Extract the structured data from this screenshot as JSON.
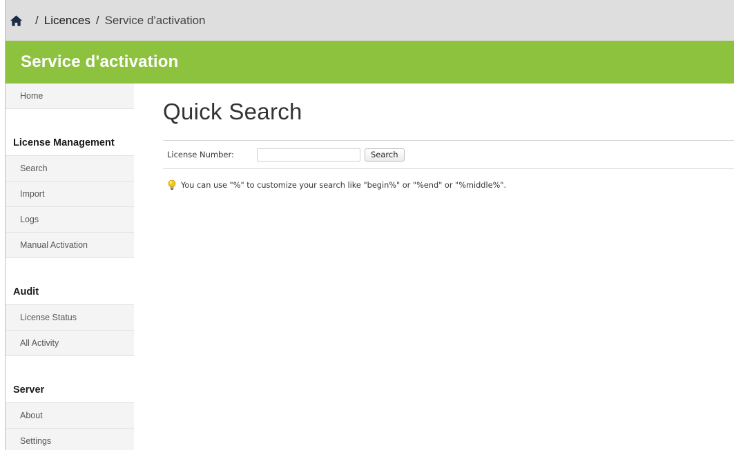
{
  "breadcrumb": {
    "home_icon": "home-icon",
    "separator": "/",
    "items": [
      {
        "label": "Licences"
      },
      {
        "label": "Service d'activation"
      }
    ]
  },
  "header": {
    "title": "Service d'activation",
    "color": "#8dc23f"
  },
  "sidebar": {
    "home": "Home",
    "sections": [
      {
        "title": "License Management",
        "items": [
          "Search",
          "Import",
          "Logs",
          "Manual Activation"
        ]
      },
      {
        "title": "Audit",
        "items": [
          "License Status",
          "All Activity"
        ]
      },
      {
        "title": "Server",
        "items": [
          "About",
          "Settings"
        ]
      }
    ]
  },
  "main": {
    "title": "Quick Search",
    "search": {
      "label": "License Number:",
      "value": "",
      "placeholder": "",
      "button_label": "Search"
    },
    "hint": {
      "icon": "lightbulb-icon",
      "text": "You can use \"%\" to customize your search like \"begin%\" or \"%end\" or \"%middle%\"."
    }
  }
}
